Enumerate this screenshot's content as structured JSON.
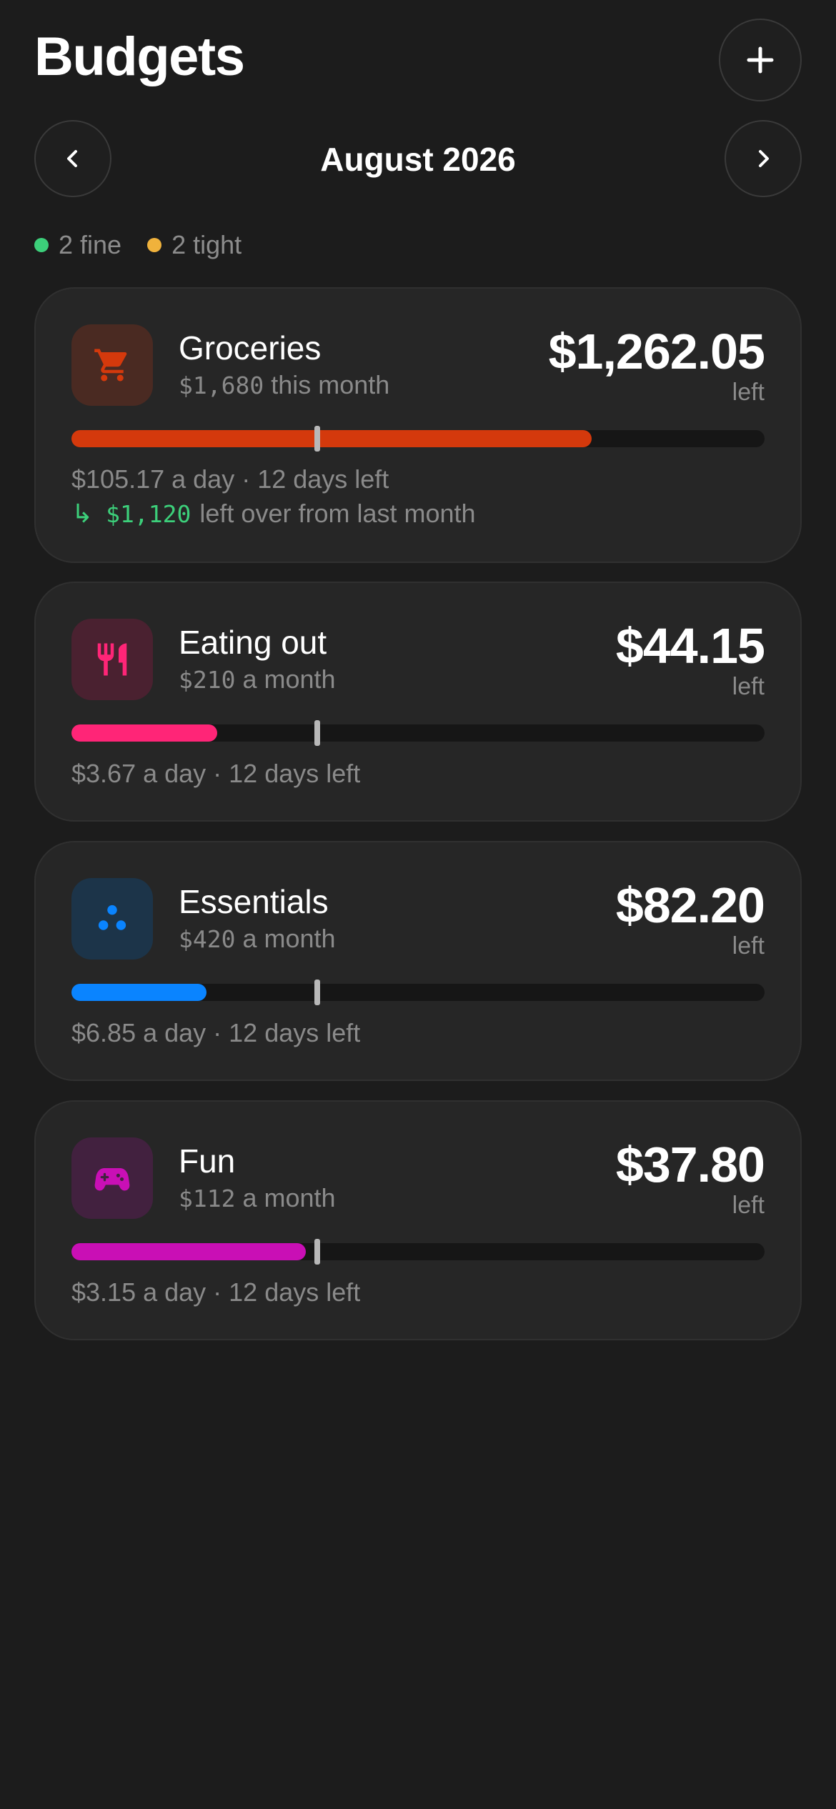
{
  "header": {
    "title": "Budgets",
    "add_icon": "plus-icon"
  },
  "month_nav": {
    "label": "August 2026",
    "prev_icon": "chevron-left-icon",
    "next_icon": "chevron-right-icon"
  },
  "summary": {
    "fine_label": "2 fine",
    "fine_color": "#3ccf7a",
    "tight_label": "2 tight",
    "tight_color": "#f0b23c"
  },
  "budgets": [
    {
      "name": "Groceries",
      "budget_amount": "$1,680",
      "budget_suffix": " this month",
      "left_amount": "$1,262.05",
      "left_label": "left",
      "daily": "$105.17 a day · 12 days left",
      "rollover_arrow": "↳",
      "rollover_amount": "$1,120",
      "rollover_text": "left over from last month",
      "icon": "cart-icon",
      "color": "#d4390c",
      "icon_bg": "#4a2a22",
      "progress_fraction": 0.75,
      "today_fraction": 0.355
    },
    {
      "name": "Eating out",
      "budget_amount": "$210",
      "budget_suffix": " a month",
      "left_amount": "$44.15",
      "left_label": "left",
      "daily": "$3.67 a day · 12 days left",
      "icon": "fork-knife-icon",
      "color": "#ff2577",
      "icon_bg": "#4a2130",
      "progress_fraction": 0.21,
      "today_fraction": 0.355
    },
    {
      "name": "Essentials",
      "budget_amount": "$420",
      "budget_suffix": " a month",
      "left_amount": "$82.20",
      "left_label": "left",
      "daily": "$6.85 a day · 12 days left",
      "icon": "three-dots-icon",
      "color": "#0a84ff",
      "icon_bg": "#1c3449",
      "progress_fraction": 0.195,
      "today_fraction": 0.355
    },
    {
      "name": "Fun",
      "budget_amount": "$112",
      "budget_suffix": " a month",
      "left_amount": "$37.80",
      "left_label": "left",
      "daily": "$3.15 a day · 12 days left",
      "icon": "gamepad-icon",
      "color": "#c90fb5",
      "icon_bg": "#42213f",
      "progress_fraction": 0.338,
      "today_fraction": 0.355
    }
  ]
}
